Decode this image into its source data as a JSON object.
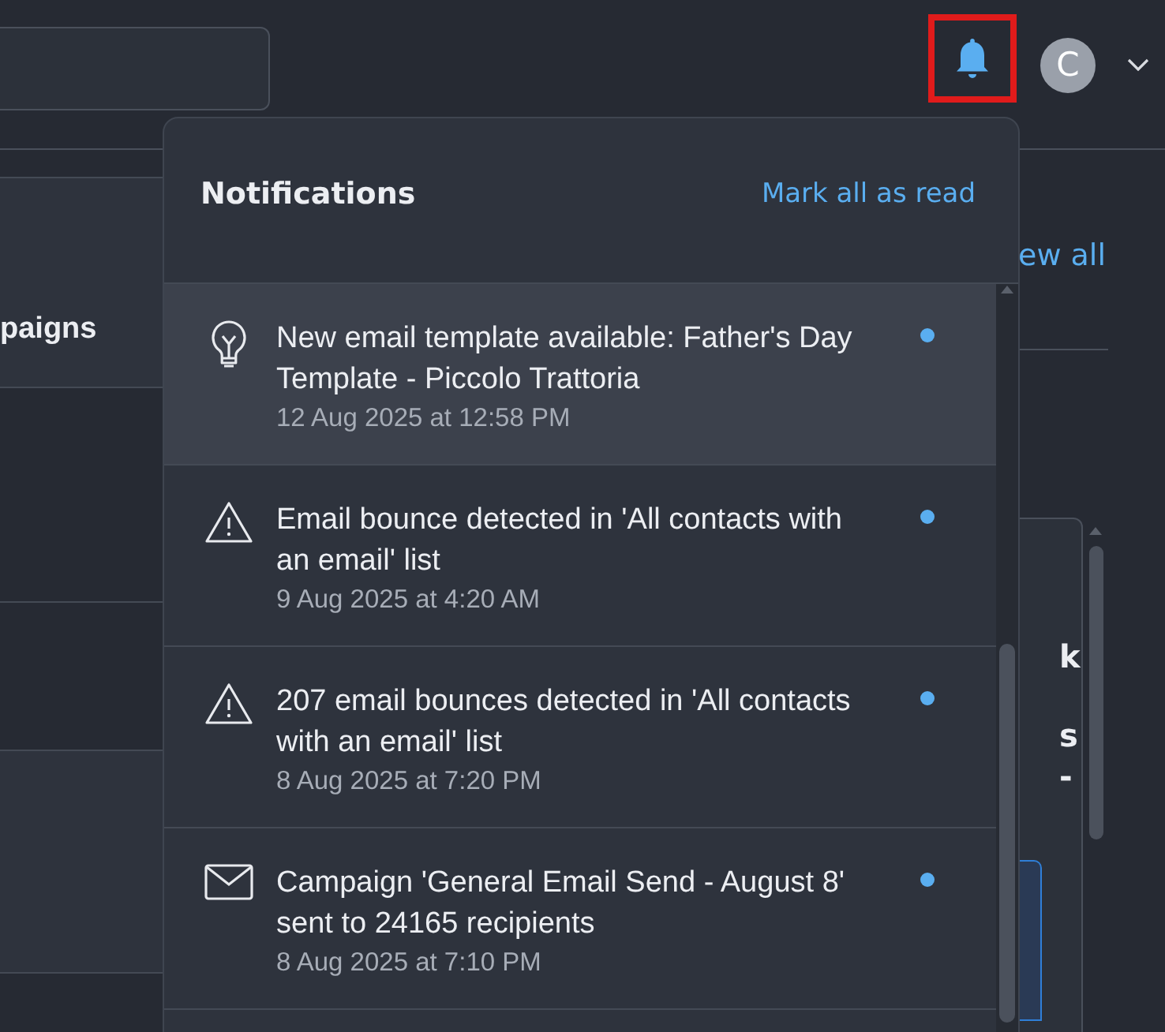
{
  "topbar": {
    "avatar": "C",
    "bell_highlighted": true
  },
  "background": {
    "left_card_title": "paigns",
    "view_all_link": "ew all",
    "right_card_fragments": [
      "k",
      "s",
      "-"
    ]
  },
  "notifications": {
    "title": "Notifications",
    "mark_all": "Mark all as read",
    "items": [
      {
        "kind": "bulb",
        "text": "New email template available: Father's Day Template - Piccolo Trattoria",
        "time": "12 Aug 2025 at 12:58 PM",
        "unread": true,
        "selected": true
      },
      {
        "kind": "warning",
        "text": "Email bounce detected in 'All contacts with an email' list",
        "time": "9 Aug 2025 at 4:20 AM",
        "unread": true,
        "selected": false
      },
      {
        "kind": "warning",
        "text": "207 email bounces detected in 'All contacts with an email' list",
        "time": "8 Aug 2025 at 7:20 PM",
        "unread": true,
        "selected": false
      },
      {
        "kind": "mail",
        "text": "Campaign 'General Email Send - August 8' sent to 24165 recipients",
        "time": "8 Aug 2025 at 7:10 PM",
        "unread": true,
        "selected": false
      }
    ]
  }
}
